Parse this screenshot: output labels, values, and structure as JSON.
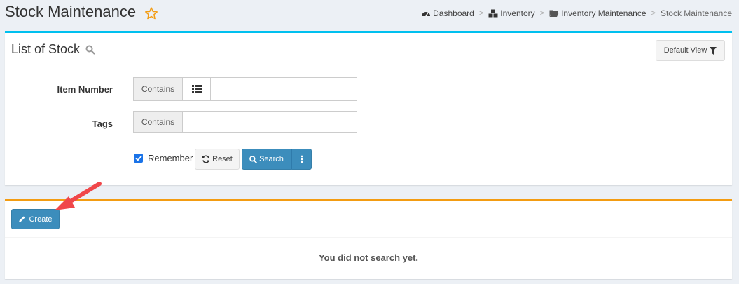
{
  "header": {
    "title": "Stock Maintenance",
    "breadcrumbs": [
      {
        "label": "Dashboard",
        "icon": "dashboard-icon"
      },
      {
        "label": "Inventory",
        "icon": "cubes-icon"
      },
      {
        "label": "Inventory Maintenance",
        "icon": "folder-open-icon"
      },
      {
        "label": "Stock Maintenance",
        "icon": ""
      }
    ],
    "separator": ">"
  },
  "search_panel": {
    "title": "List of Stock",
    "default_view_label": "Default View",
    "fields": [
      {
        "label": "Item Number",
        "operator": "Contains",
        "value": ""
      },
      {
        "label": "Tags",
        "operator": "Contains",
        "value": ""
      }
    ],
    "remember_label": "Remember",
    "remember_checked": true,
    "reset_label": "Reset",
    "search_label": "Search"
  },
  "results_panel": {
    "create_label": "Create",
    "empty_message": "You did not search yet."
  },
  "colors": {
    "info_accent": "#00c0ef",
    "warning_accent": "#f39c12",
    "primary": "#3c8dbc",
    "annotation_arrow": "#f0474a"
  }
}
